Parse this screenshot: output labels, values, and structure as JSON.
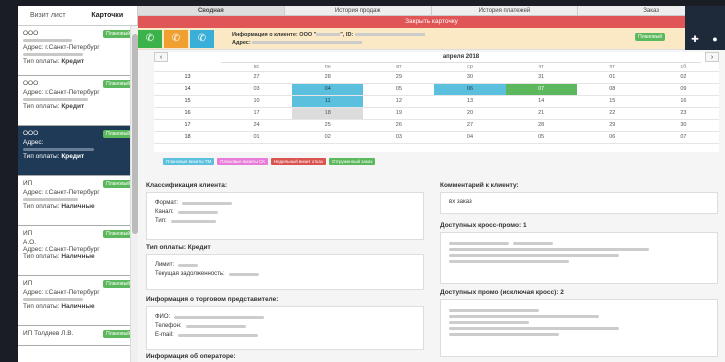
{
  "sidebar": {
    "tabs": [
      "Визит лист",
      "Карточки"
    ],
    "cards": [
      {
        "name": "ООО",
        "badge": "Плановый",
        "addr": "Адрес: г.Санкт-Петербург",
        "pay_label": "Тип оплаты:",
        "pay_value": "Кредит"
      },
      {
        "name": "ООО",
        "badge": "Плановый",
        "addr": "Адрес: г.Санкт-Петербург",
        "pay_label": "Тип оплаты:",
        "pay_value": "Кредит"
      },
      {
        "name": "ООО",
        "badge": "Плановый",
        "addr": "Адрес:",
        "pay_label": "Тип оплаты:",
        "pay_value": "Кредит"
      },
      {
        "name": "ИП",
        "badge": "Плановый",
        "addr": "Адрес: г.Санкт-Петербург",
        "pay_label": "Тип оплаты:",
        "pay_value": "Наличные"
      },
      {
        "name": "ИП",
        "badge": "Плановый",
        "addr": "А.О.",
        "addr2": "Адрес: г.Санкт-Петербург",
        "pay_label": "Тип оплаты:",
        "pay_value": "Наличные"
      },
      {
        "name": "ИП",
        "badge": "Плановый",
        "addr": "Адрес: г.Санкт-Петербург",
        "pay_label": "Тип оплаты:",
        "pay_value": "Наличные"
      },
      {
        "name": "ИП Толдиев Л.В.",
        "badge": "Плановый"
      }
    ]
  },
  "top_tabs": [
    "Сводная",
    "История продаж",
    "История платежей",
    "Заказ"
  ],
  "close_bar": "Закрыть карточку",
  "info": {
    "client_label": "Информация о клиенте: ООО \"",
    "client_mid": "\", ID:",
    "address_label": "Адрес:",
    "badge": "Плановый"
  },
  "calendar": {
    "title": "апреля 2018",
    "prev": "‹",
    "next": "›",
    "days": [
      "вс",
      "пн",
      "вт",
      "ср",
      "чт",
      "пт",
      "сб"
    ],
    "weeks": [
      {
        "n": "13",
        "d": [
          "27",
          "28",
          "29",
          "30",
          "31",
          "01",
          "02"
        ]
      },
      {
        "n": "14",
        "d": [
          "03",
          "04",
          "05",
          "06",
          "07",
          "08",
          "09"
        ]
      },
      {
        "n": "15",
        "d": [
          "10",
          "11",
          "12",
          "13",
          "14",
          "15",
          "16"
        ]
      },
      {
        "n": "16",
        "d": [
          "17",
          "18",
          "19",
          "20",
          "21",
          "22",
          "23"
        ]
      },
      {
        "n": "17",
        "d": [
          "24",
          "25",
          "26",
          "27",
          "28",
          "29",
          "30"
        ]
      },
      {
        "n": "18",
        "d": [
          "01",
          "02",
          "03",
          "04",
          "05",
          "06",
          "07"
        ]
      }
    ]
  },
  "legend": [
    {
      "label": "Плановые визиты ТМ",
      "color": "#5bc0de"
    },
    {
      "label": "Плановые визиты СК",
      "color": "#e87cd8"
    },
    {
      "label": "Недельный визит отказ",
      "color": "#d9534f"
    },
    {
      "label": "Отгруженный заказ",
      "color": "#5cb85c"
    }
  ],
  "classification": {
    "title": "Классификация клиента:",
    "format": "Формат:",
    "channel": "Канал:",
    "type": "Тип:"
  },
  "payment": {
    "title": "Тип оплаты: Кредит",
    "limit": "Лимит:",
    "debt": "Текущая задолженность:"
  },
  "rep": {
    "title": "Информация о торговом представителе:",
    "fio": "ФИО:",
    "phone": "Телефон:",
    "email": "E-mail:"
  },
  "operator": {
    "title": "Информация об операторе:"
  },
  "comment": {
    "title": "Комментарий к клиенту:",
    "text": "вх заказ"
  },
  "cross_promo": {
    "title": "Доступных кросс-промо: 1"
  },
  "promo": {
    "title": "Доступных промо (исключая кросс): 2"
  },
  "icons": {
    "call_green": "phone-icon",
    "call_orange": "phone-icon",
    "call_blue": "phone-icon",
    "add": "plus-icon",
    "user": "user-icon"
  }
}
